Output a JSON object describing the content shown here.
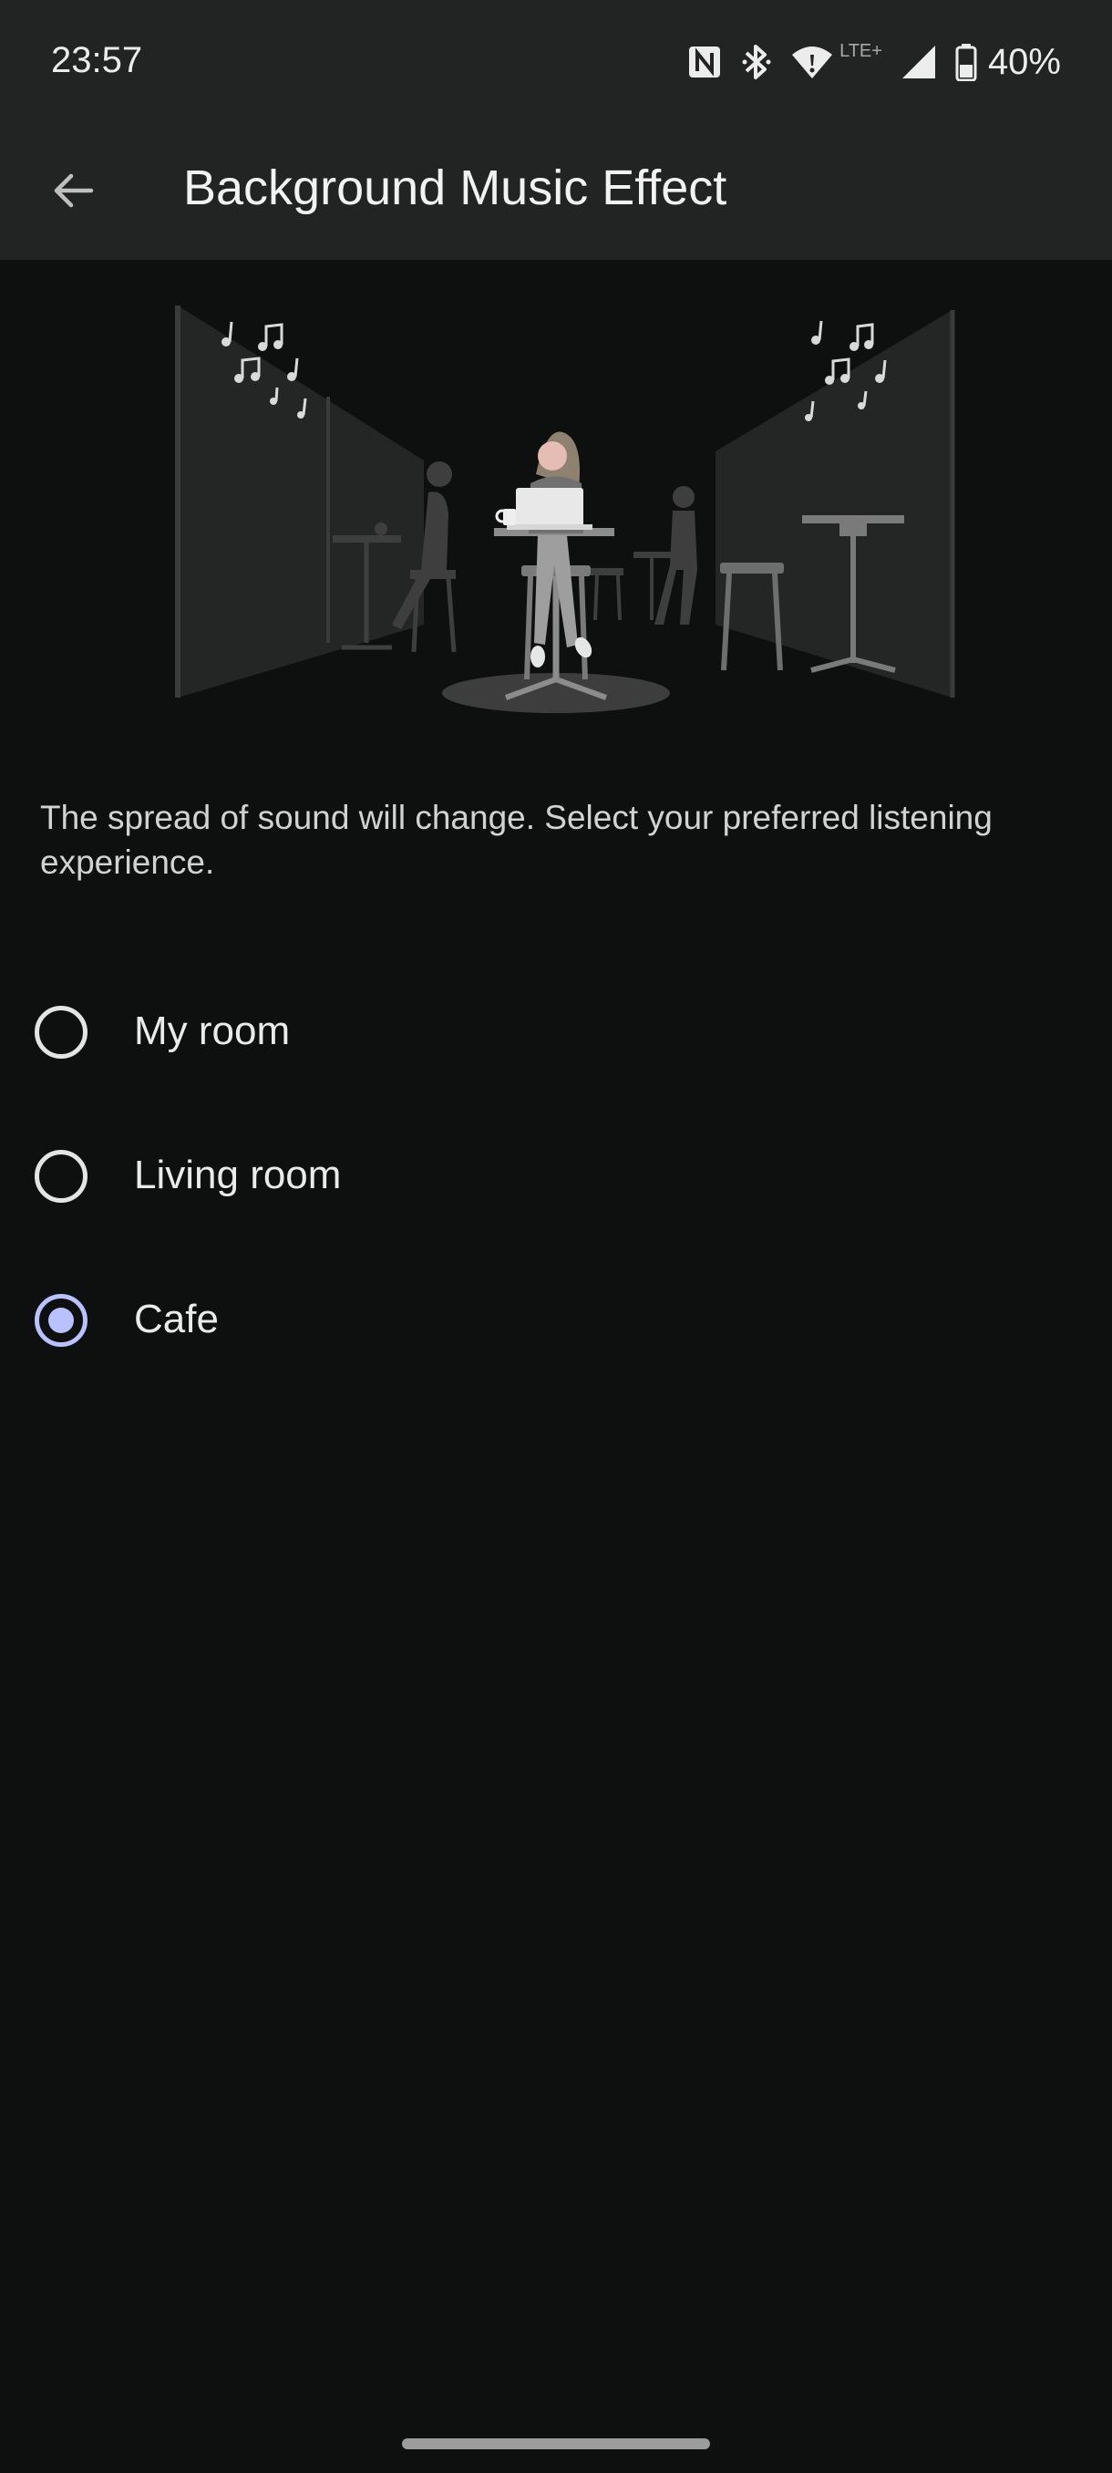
{
  "status_bar": {
    "time": "23:57",
    "network_label": "LTE+",
    "battery_percent": "40%",
    "icons": [
      "nfc-icon",
      "bluetooth-icon",
      "wifi-icon",
      "cell-signal-icon",
      "battery-icon"
    ]
  },
  "app_bar": {
    "back_icon": "arrow-left-icon",
    "title": "Background Music Effect"
  },
  "illustration": {
    "subject": "cafe-illustration"
  },
  "description": "The spread of sound will change. Select your preferred listening experience.",
  "options": [
    {
      "label": "My room",
      "selected": false
    },
    {
      "label": "Living room",
      "selected": false
    },
    {
      "label": "Cafe",
      "selected": true
    }
  ],
  "colors": {
    "background": "#0e1010",
    "app_bar": "#222323",
    "accent": "#b9c2ff"
  }
}
